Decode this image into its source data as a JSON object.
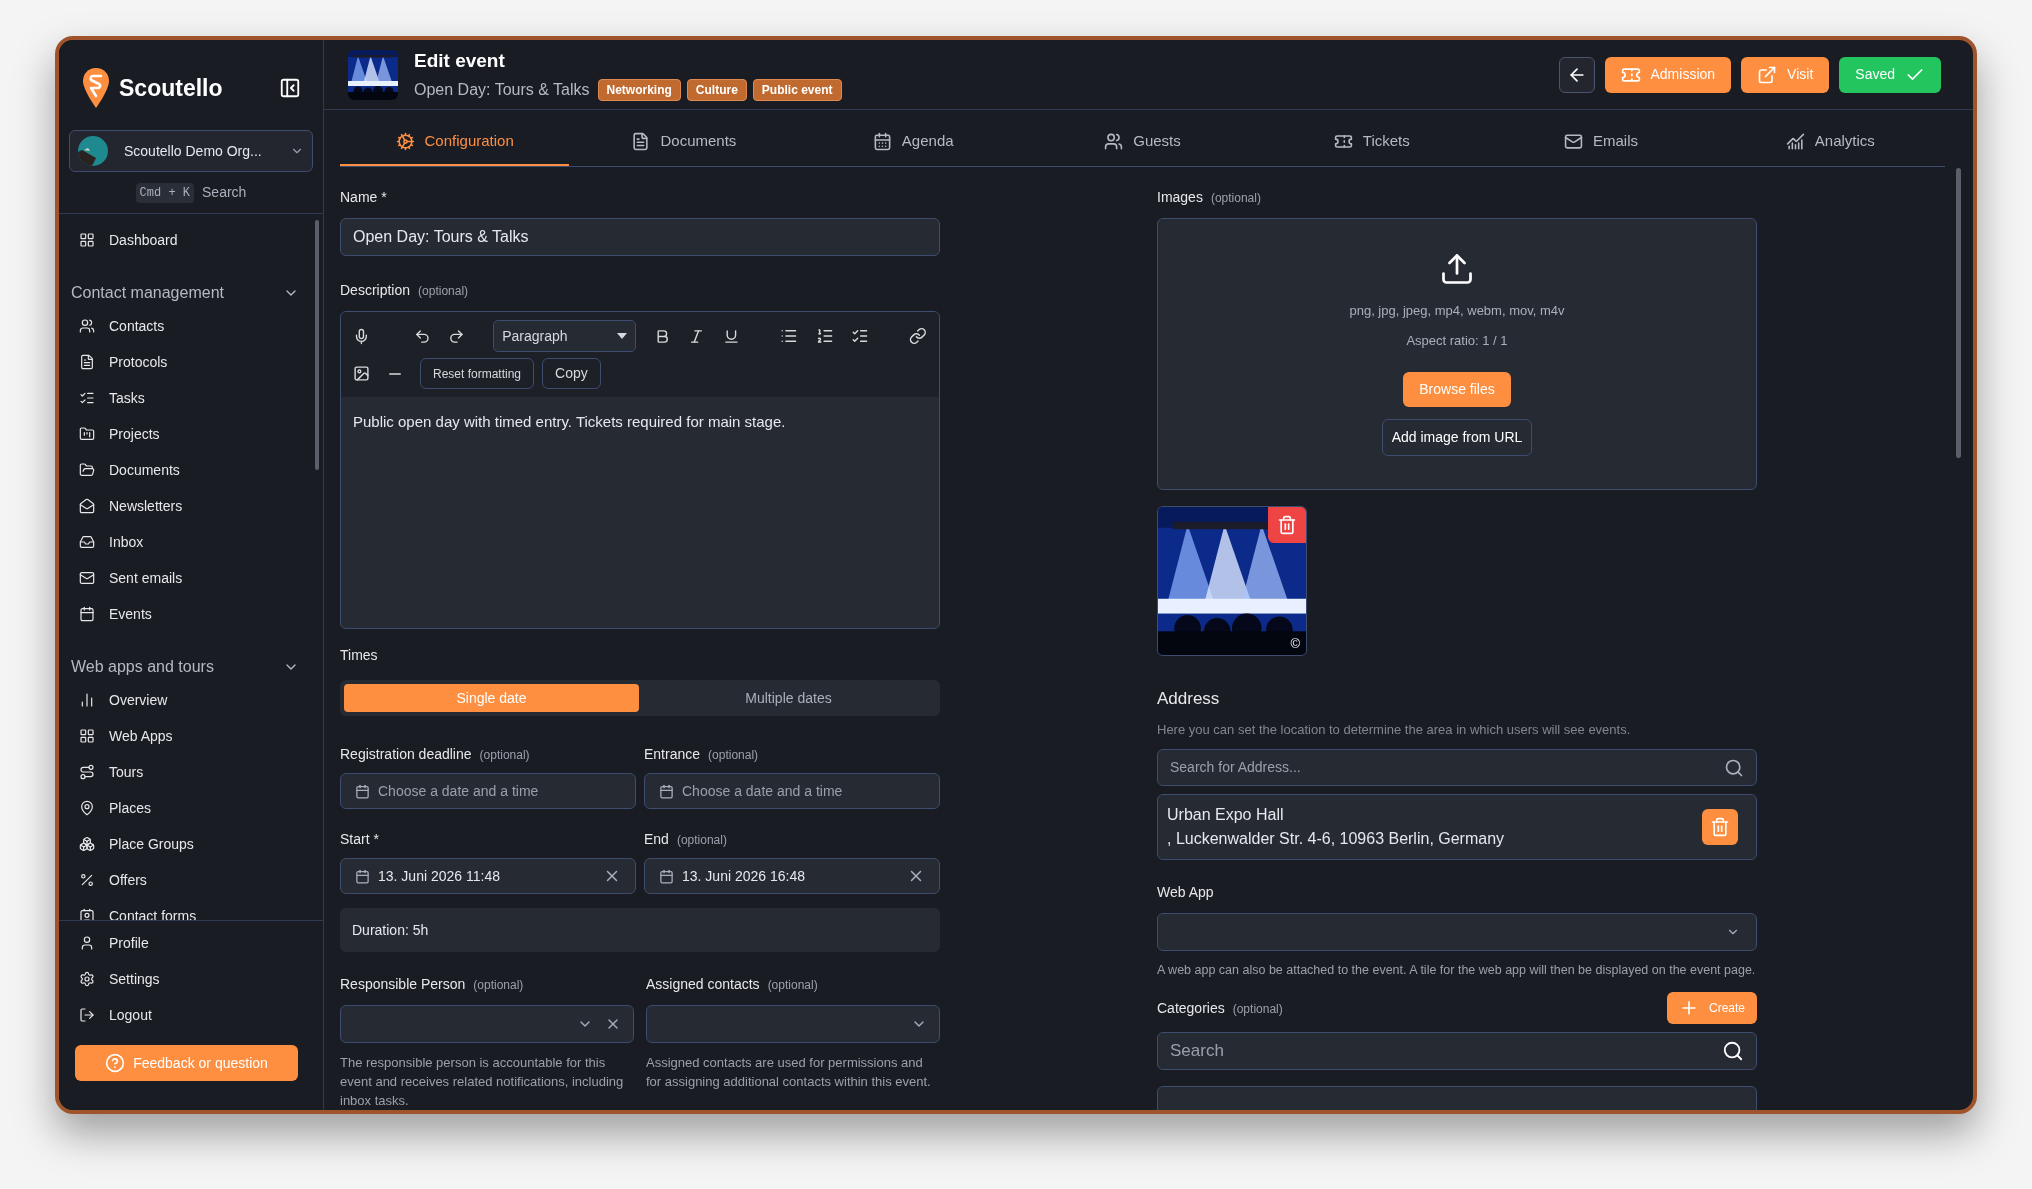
{
  "sidebar": {
    "brand": "Scoutello",
    "organization": "Scoutello Demo Org...",
    "shortcut": "Cmd + K",
    "search_label": "Search",
    "top_items": [
      {
        "label": "Dashboard"
      }
    ],
    "groups": [
      {
        "title": "Contact management",
        "expanded": true,
        "items": [
          {
            "label": "Contacts"
          },
          {
            "label": "Protocols"
          },
          {
            "label": "Tasks"
          },
          {
            "label": "Projects"
          },
          {
            "label": "Documents"
          },
          {
            "label": "Newsletters"
          },
          {
            "label": "Inbox"
          },
          {
            "label": "Sent emails"
          },
          {
            "label": "Events"
          }
        ]
      },
      {
        "title": "Web apps and tours",
        "expanded": true,
        "items": [
          {
            "label": "Overview"
          },
          {
            "label": "Web Apps"
          },
          {
            "label": "Tours"
          },
          {
            "label": "Places"
          },
          {
            "label": "Place Groups"
          },
          {
            "label": "Offers"
          },
          {
            "label": "Contact forms"
          }
        ]
      }
    ],
    "bottom_items": [
      {
        "label": "Profile"
      },
      {
        "label": "Settings"
      },
      {
        "label": "Logout"
      }
    ],
    "feedback_button": "Feedback or question"
  },
  "header": {
    "title": "Edit event",
    "subtitle": "Open Day: Tours & Talks",
    "tags": [
      "Networking",
      "Culture",
      "Public event"
    ],
    "buttons": [
      {
        "kind": "back"
      },
      {
        "kind": "primary",
        "label": "Admission"
      },
      {
        "kind": "primary",
        "label": "Visit"
      },
      {
        "kind": "success",
        "label": "Saved"
      }
    ]
  },
  "tabs": [
    {
      "label": "Configuration",
      "selected": true
    },
    {
      "label": "Documents",
      "selected": false
    },
    {
      "label": "Agenda",
      "selected": false
    },
    {
      "label": "Guests",
      "selected": false
    },
    {
      "label": "Tickets",
      "selected": false
    },
    {
      "label": "Emails",
      "selected": false
    },
    {
      "label": "Analytics",
      "selected": false
    }
  ],
  "form": {
    "name": {
      "label": "Name *",
      "value": "Open Day: Tours & Talks"
    },
    "description": {
      "label": "Description",
      "hint": "(optional)",
      "format": "Paragraph",
      "reset_button": "Reset formatting",
      "copy_button": "Copy",
      "value": "Public open day with timed entry. Tickets required for main stage."
    },
    "times": {
      "label": "Times",
      "modes": [
        {
          "label": "Single date",
          "selected": true
        },
        {
          "label": "Multiple dates",
          "selected": false
        }
      ],
      "fields": [
        {
          "label": "Registration deadline",
          "hint": "(optional)",
          "placeholder": "Choose a date and a time"
        },
        {
          "label": "Entrance",
          "hint": "(optional)",
          "placeholder": "Choose a date and a time"
        },
        {
          "label": "Start *",
          "value": "13. Juni 2026 11:48"
        },
        {
          "label": "End",
          "hint": "(optional)",
          "value": "13. Juni 2026 16:48"
        }
      ],
      "duration": "Duration: 5h"
    },
    "responsible": {
      "label": "Responsible Person",
      "hint": "(optional)",
      "help": "The responsible person is accountable for this event and receives related notifications, including inbox tasks."
    },
    "assigned": {
      "label": "Assigned contacts",
      "hint": "(optional)",
      "help": "Assigned contacts are used for permissions and for assigning additional contacts within this event."
    }
  },
  "media": {
    "label": "Images",
    "hint": "(optional)",
    "formats": "png, jpg, jpeg, mp4, webm, mov, m4v",
    "aspect": "Aspect ratio: 1 / 1",
    "browse_button": "Browse files",
    "url_button": "Add image from URL",
    "images": [
      {
        "kind": "picture",
        "copyright_mark": "©"
      }
    ]
  },
  "address": {
    "label": "Address",
    "help": "Here you can set the location to determine the area in which users will see events.",
    "placeholder": "Search for Address...",
    "name": "Urban Expo Hall",
    "line": ", Luckenwalder Str. 4-6, 10963 Berlin, Germany"
  },
  "web_app": {
    "label": "Web App",
    "help": "A web app can also be attached to the event. A tile for the web app will then be displayed on the event page."
  },
  "categories": {
    "label": "Categories",
    "hint": "(optional)",
    "create_button": "Create",
    "placeholder": "Search"
  }
}
